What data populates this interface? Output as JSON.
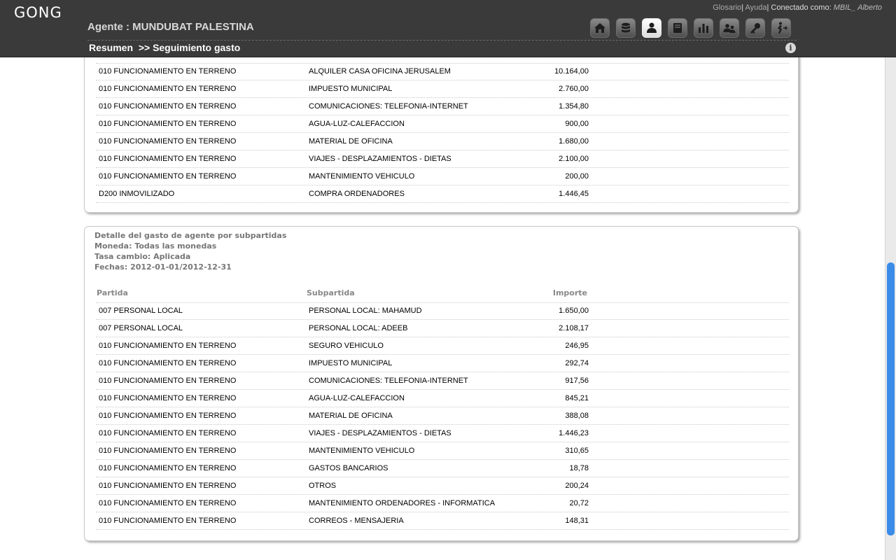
{
  "app": {
    "logo": "GONG"
  },
  "header": {
    "agent_title": "Agente : MUNDUBAT PALESTINA",
    "links": {
      "glosario": "Glosario",
      "ayuda": "Ayuda",
      "conectado": "Conectado como:",
      "user": "MBIL_ Alberto"
    },
    "breadcrumb": {
      "resumen": "Resumen",
      "separator": ">>",
      "current": "Seguimiento gasto"
    },
    "nav_icons": [
      "home-icon",
      "database-icon",
      "user-icon",
      "book-icon",
      "bar-chart-icon",
      "users-icon",
      "key-icon",
      "logout-icon"
    ],
    "active_icon": "user-icon"
  },
  "table1": {
    "rows": [
      {
        "partida": "010 FUNCIONAMIENTO EN TERRENO",
        "subpartida": "ALQUILER CASA OFICINA JERUSALEM",
        "importe": "10.164,00"
      },
      {
        "partida": "010 FUNCIONAMIENTO EN TERRENO",
        "subpartida": "IMPUESTO MUNICIPAL",
        "importe": "2.760,00"
      },
      {
        "partida": "010 FUNCIONAMIENTO EN TERRENO",
        "subpartida": "COMUNICACIONES: TELEFONIA-INTERNET",
        "importe": "1.354,80"
      },
      {
        "partida": "010 FUNCIONAMIENTO EN TERRENO",
        "subpartida": "AGUA-LUZ-CALEFACCION",
        "importe": "900,00"
      },
      {
        "partida": "010 FUNCIONAMIENTO EN TERRENO",
        "subpartida": "MATERIAL DE OFICINA",
        "importe": "1.680,00"
      },
      {
        "partida": "010 FUNCIONAMIENTO EN TERRENO",
        "subpartida": "VIAJES - DESPLAZAMIENTOS - DIETAS",
        "importe": "2.100,00"
      },
      {
        "partida": "010 FUNCIONAMIENTO EN TERRENO",
        "subpartida": "MANTENIMIENTO VEHICULO",
        "importe": "200,00"
      },
      {
        "partida": "D200 INMOVILIZADO",
        "subpartida": "COMPRA ORDENADORES",
        "importe": "1.446,45"
      }
    ]
  },
  "section2": {
    "title": "Detalle del gasto de agente por subpartidas",
    "moneda": "Moneda: Todas las monedas",
    "tasa": "Tasa cambio: Aplicada",
    "fechas": "Fechas: 2012-01-01/2012-12-31",
    "headers": {
      "partida": "Partida",
      "subpartida": "Subpartida",
      "importe": "Importe"
    },
    "rows": [
      {
        "partida": "007 PERSONAL LOCAL",
        "subpartida": "PERSONAL LOCAL: MAHAMUD",
        "importe": "1.650,00"
      },
      {
        "partida": "007 PERSONAL LOCAL",
        "subpartida": "PERSONAL LOCAL: ADEEB",
        "importe": "2.108,17"
      },
      {
        "partida": "010 FUNCIONAMIENTO EN TERRENO",
        "subpartida": "SEGURO VEHICULO",
        "importe": "246,95"
      },
      {
        "partida": "010 FUNCIONAMIENTO EN TERRENO",
        "subpartida": "IMPUESTO MUNICIPAL",
        "importe": "292,74"
      },
      {
        "partida": "010 FUNCIONAMIENTO EN TERRENO",
        "subpartida": "COMUNICACIONES: TELEFONIA-INTERNET",
        "importe": "917,56"
      },
      {
        "partida": "010 FUNCIONAMIENTO EN TERRENO",
        "subpartida": "AGUA-LUZ-CALEFACCION",
        "importe": "845,21"
      },
      {
        "partida": "010 FUNCIONAMIENTO EN TERRENO",
        "subpartida": "MATERIAL DE OFICINA",
        "importe": "388,08"
      },
      {
        "partida": "010 FUNCIONAMIENTO EN TERRENO",
        "subpartida": "VIAJES - DESPLAZAMIENTOS - DIETAS",
        "importe": "1.446,23"
      },
      {
        "partida": "010 FUNCIONAMIENTO EN TERRENO",
        "subpartida": "MANTENIMIENTO VEHICULO",
        "importe": "310,65"
      },
      {
        "partida": "010 FUNCIONAMIENTO EN TERRENO",
        "subpartida": "GASTOS BANCARIOS",
        "importe": "18,78"
      },
      {
        "partida": "010 FUNCIONAMIENTO EN TERRENO",
        "subpartida": "OTROS",
        "importe": "200,24"
      },
      {
        "partida": "010 FUNCIONAMIENTO EN TERRENO",
        "subpartida": "MANTENIMIENTO ORDENADORES - INFORMATICA",
        "importe": "20,72"
      },
      {
        "partida": "010 FUNCIONAMIENTO EN TERRENO",
        "subpartida": "CORREOS - MENSAJERIA",
        "importe": "148,31"
      }
    ]
  },
  "colors": {
    "header_bg": "#3a3a3a",
    "scroll_thumb": "#3b8be8",
    "muted_text": "#777777"
  }
}
